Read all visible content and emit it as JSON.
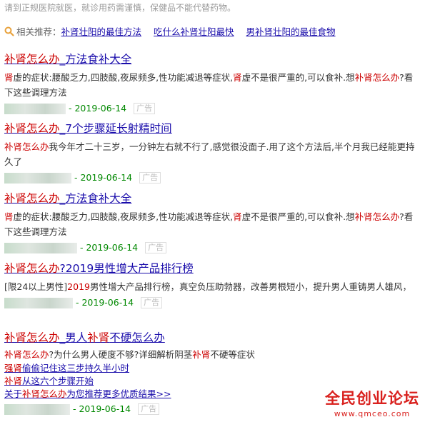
{
  "notice": "请到正规医院就医，就诊用药需谨慎，保健品不能代替药物。",
  "related": {
    "label": "相关推荐：",
    "links": [
      "补肾壮阳的最佳方法",
      "吃什么补肾壮阳最快",
      "男补肾壮阳的最佳食物"
    ]
  },
  "results": [
    {
      "title": [
        "补肾怎么办",
        "_方法食补大全"
      ],
      "desc": [
        "肾",
        "虚的症状:腰酸乏力,四肢酸,夜尿频多,性功能减退等症状,",
        "肾",
        "虚不是很严重的,可以食补.想",
        "补肾怎么办",
        "?看下这些调理方法"
      ],
      "date": "- 2019-06-14",
      "ad": "广告"
    },
    {
      "title": [
        "补肾怎么办",
        "_7个步骤延长射精时间"
      ],
      "desc": [
        "补肾怎么办",
        "我今年才二十三岁，一分钟左右就不行了,感觉很没面子.用了这个方法后,半个月我已经能更持久了"
      ],
      "date": "- 2019-06-14",
      "ad": "广告"
    },
    {
      "title": [
        "补肾怎么办",
        "_方法食补大全"
      ],
      "desc": [
        "肾",
        "虚的症状:腰酸乏力,四肢酸,夜尿频多,性功能减退等症状,",
        "肾",
        "虚不是很严重的,可以食补.想",
        "补肾怎么办",
        "?看下这些调理方法"
      ],
      "date": "- 2019-06-14",
      "ad": "广告"
    },
    {
      "title": [
        "补肾怎么办",
        "?2019男性增大产品排行榜"
      ],
      "desc": [
        "[限24以上男性]",
        "2019",
        "男性增大产品排行榜，真空负压助勃器，改善男根短小，提升男人重铸男人雄风，"
      ],
      "date": "- 2019-06-14",
      "ad": "广告"
    },
    {
      "title": [
        "补肾怎么办",
        "_男人",
        "补肾",
        "不硬怎么办"
      ],
      "desc": [
        "补肾怎么办",
        "?为什么男人硬度不够?详细解析阴茎",
        "补肾",
        "不硬等症状"
      ],
      "sublinks": [
        [
          "强肾",
          "偷偷记住这三步持久半小时"
        ],
        [
          "补肾",
          "从这六个步骤开始"
        ],
        [
          "关于",
          "补肾怎么办",
          "为您推荐更多优质结果>>"
        ]
      ],
      "date": "- 2019-06-14",
      "ad": "广告"
    }
  ],
  "watermark": {
    "main": "全民创业论坛",
    "url": "www.qmceo.com"
  }
}
